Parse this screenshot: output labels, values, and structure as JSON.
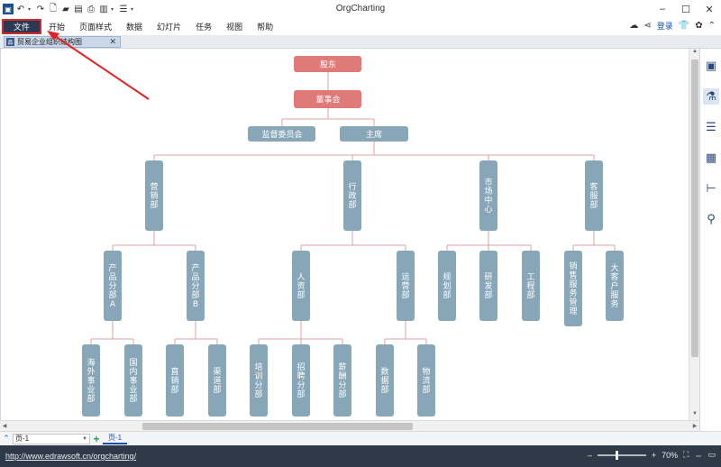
{
  "window": {
    "title": "OrgCharting",
    "min_icon": "minimize-icon",
    "max_icon": "maximize-icon",
    "close_icon": "close-icon"
  },
  "quick_access": [
    "app-icon",
    "undo-icon",
    "redo-icon",
    "new-icon",
    "open-icon",
    "save-icon",
    "print-icon",
    "export-icon",
    "more-icon"
  ],
  "menu": {
    "file": "文件",
    "items": [
      "开始",
      "页面样式",
      "数据",
      "幻灯片",
      "任务",
      "视图",
      "帮助"
    ],
    "login": "登录"
  },
  "doc_tab": {
    "label": "贸易企业组织结构图"
  },
  "org": {
    "root": "股东",
    "board": "董事会",
    "supervisory": "监督委员会",
    "chair": "主席",
    "departments": [
      "营销部",
      "行政部",
      "市场中心",
      "客服部"
    ],
    "sales_subs": [
      "产品分部A",
      "产品分部B"
    ],
    "sales_a_subs": [
      "海外事业部",
      "国内事业部"
    ],
    "sales_b_subs": [
      "直销部",
      "渠道部"
    ],
    "admin_subs": [
      "人资部",
      "运营部"
    ],
    "hr_subs": [
      "培训分部",
      "招聘分部",
      "薪酬分部"
    ],
    "ops_subs": [
      "数据部",
      "物流部"
    ],
    "market_subs": [
      "规划部",
      "研发部",
      "工程部"
    ],
    "service_subs": [
      "销售服务管理",
      "大客户服务"
    ],
    "colors": {
      "top": "#e07a78",
      "node": "#87a7b8",
      "line": "#e0a0a0"
    }
  },
  "pages": {
    "selector": "页-1",
    "tab": "页-1"
  },
  "status": {
    "url": "http://www.edrawsoft.cn/orgcharting/",
    "zoom": "70%"
  }
}
